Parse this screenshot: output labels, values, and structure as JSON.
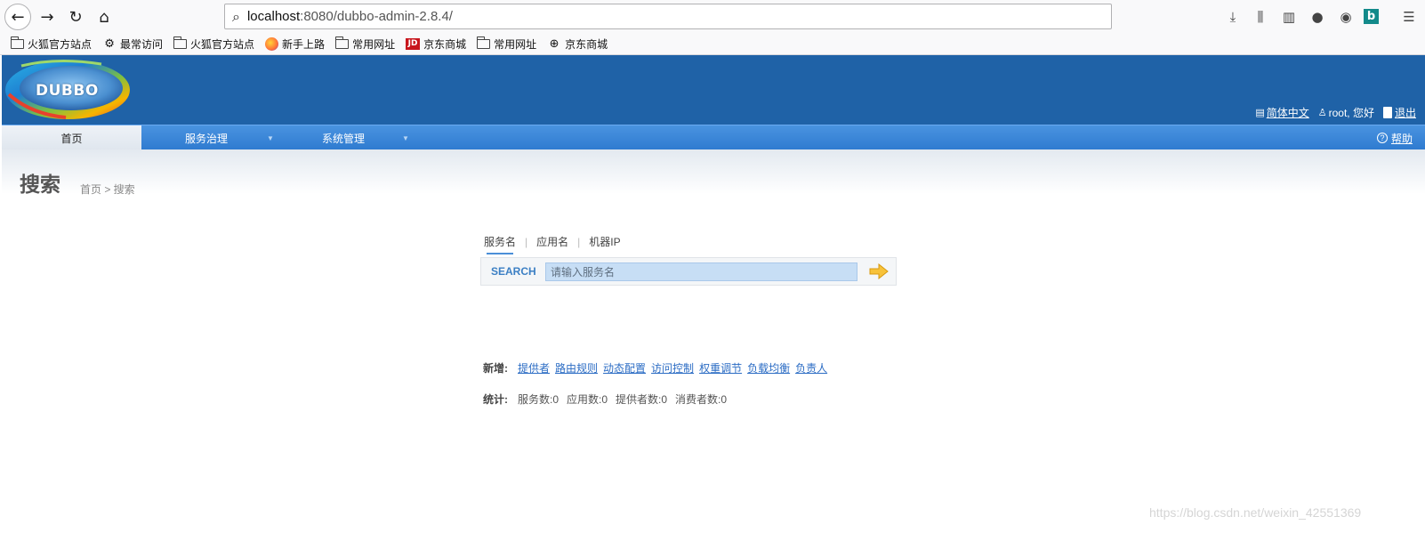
{
  "browser": {
    "url_host": "localhost",
    "url_path": ":8080/dubbo-admin-2.8.4/",
    "bookmarks": [
      {
        "icon": "folder-icon",
        "label": "火狐官方站点"
      },
      {
        "icon": "gear-icon",
        "label": "最常访问"
      },
      {
        "icon": "folder-icon",
        "label": "火狐官方站点"
      },
      {
        "icon": "firefox-icon",
        "label": "新手上路"
      },
      {
        "icon": "folder-icon",
        "label": "常用网址"
      },
      {
        "icon": "jd-icon",
        "label": "京东商城",
        "icon_text": "JD"
      },
      {
        "icon": "folder-icon",
        "label": "常用网址"
      },
      {
        "icon": "globe-icon",
        "label": "京东商城"
      }
    ]
  },
  "header": {
    "logo_text": "DUBBO",
    "language": "简体中文",
    "user_greeting": "root, 您好",
    "logout": "退出"
  },
  "menu": {
    "home": "首页",
    "service_governance": "服务治理",
    "system_management": "系统管理",
    "help": "帮助"
  },
  "page": {
    "title": "搜索",
    "breadcrumb": "首页 > 搜索"
  },
  "search": {
    "tabs": [
      "服务名",
      "应用名",
      "机器IP"
    ],
    "active_tab": 0,
    "label": "SEARCH",
    "placeholder": "请输入服务名"
  },
  "add": {
    "label": "新增:",
    "links": [
      "提供者",
      "路由规则",
      "动态配置",
      "访问控制",
      "权重调节",
      "负载均衡",
      "负责人"
    ]
  },
  "stats": {
    "label": "统计:",
    "items": [
      "服务数:0",
      "应用数:0",
      "提供者数:0",
      "消费者数:0"
    ]
  },
  "watermark": "https://blog.csdn.net/weixin_42551369",
  "colors": {
    "header_blue": "#1f62a7",
    "menu_blue": "#2f7bd0",
    "link_blue": "#2b6cc4"
  }
}
